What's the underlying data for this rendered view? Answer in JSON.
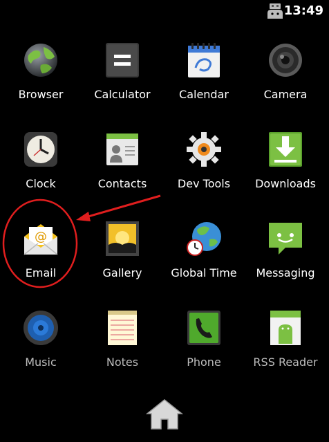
{
  "status_bar": {
    "time": "13:49",
    "icons": [
      "usb-debugging-icon"
    ]
  },
  "apps": [
    {
      "label": "Browser",
      "icon": "browser-globe-icon"
    },
    {
      "label": "Calculator",
      "icon": "calculator-icon"
    },
    {
      "label": "Calendar",
      "icon": "calendar-icon"
    },
    {
      "label": "Camera",
      "icon": "camera-icon"
    },
    {
      "label": "Clock",
      "icon": "clock-icon"
    },
    {
      "label": "Contacts",
      "icon": "contacts-icon"
    },
    {
      "label": "Dev Tools",
      "icon": "dev-tools-gear-icon"
    },
    {
      "label": "Downloads",
      "icon": "downloads-icon"
    },
    {
      "label": "Email",
      "icon": "email-envelope-icon"
    },
    {
      "label": "Gallery",
      "icon": "gallery-icon"
    },
    {
      "label": "Global Time",
      "icon": "global-time-icon"
    },
    {
      "label": "Messaging",
      "icon": "messaging-icon"
    },
    {
      "label": "Music",
      "icon": "music-speaker-icon"
    },
    {
      "label": "Notes",
      "icon": "notes-icon"
    },
    {
      "label": "Phone",
      "icon": "phone-icon"
    },
    {
      "label": "RSS Reader",
      "icon": "rss-reader-icon"
    }
  ],
  "nav": {
    "home_icon": "home-icon"
  },
  "annotation": {
    "color": "#e01e1e",
    "highlight_target": "Email"
  }
}
